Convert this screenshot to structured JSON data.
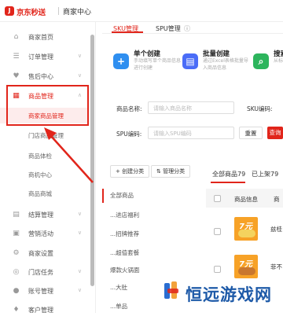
{
  "header": {
    "logo_glyph": "J",
    "brand": "京东秒送",
    "subtitle": "商家中心"
  },
  "sidebar": {
    "items": [
      {
        "label": "商家首页",
        "icon": "home-icon",
        "glyph": "⌂"
      },
      {
        "label": "订单管理",
        "icon": "order-icon",
        "glyph": "☰"
      },
      {
        "label": "售后中心",
        "icon": "aftersale-icon",
        "glyph": "♥"
      },
      {
        "label": "商品管理",
        "icon": "goods-icon",
        "glyph": "▦"
      },
      {
        "label": "结算管理",
        "icon": "settlement-icon",
        "glyph": "▤"
      },
      {
        "label": "营销活动",
        "icon": "marketing-icon",
        "glyph": "▣"
      },
      {
        "label": "商家设置",
        "icon": "settings-icon",
        "glyph": "⚙"
      },
      {
        "label": "门店任务",
        "icon": "task-icon",
        "glyph": "◎"
      },
      {
        "label": "账号管理",
        "icon": "account-icon",
        "glyph": "●"
      },
      {
        "label": "客户管理",
        "icon": "customer-icon",
        "glyph": "♦"
      }
    ],
    "sub_items": [
      "商家商品管理",
      "门店商品管理",
      "商品体检",
      "商机中心",
      "商品商城"
    ]
  },
  "tabs": [
    {
      "label": "SKU管理"
    },
    {
      "label": "SPU管理"
    },
    {
      "label": "ⓘ"
    }
  ],
  "create_cards": [
    {
      "title": "单个创建",
      "desc": "手动填写单个商品信息进行创建",
      "color": "#2f8ff0",
      "glyph": "+"
    },
    {
      "title": "批量创建",
      "desc": "通过Excel表格批量导入商品信息",
      "color": "#4a6cf7",
      "glyph": "▤"
    },
    {
      "title": "搜索",
      "desc": "从标库中搜索",
      "color": "#2db55d",
      "glyph": "⌕"
    }
  ],
  "filters": {
    "name_label": "商品名称:",
    "name_placeholder": "请输入商品名称",
    "sku_label": "SKU编码:",
    "spu_label": "SPU编码:",
    "spu_placeholder": "请输入SPU编码",
    "reset": "重置",
    "search": "查询"
  },
  "category_panel": {
    "create_btn": "+ 创建分类",
    "manage_btn": "管理分类",
    "items": [
      "全部商品",
      "...进店福利",
      "...招牌推荐",
      "...超值套餐",
      "爆款火锅面",
      "...大肚",
      "...单品"
    ]
  },
  "goods_list": {
    "stat_all": "全部商品79",
    "stat_onsale": "已上架79",
    "columns": [
      "商品信息",
      "商"
    ],
    "rows": [
      {
        "badge": "7元",
        "name": "兹桂"
      },
      {
        "badge": "7元",
        "name": "菲不"
      }
    ]
  },
  "watermark": {
    "text": "恒远游戏网"
  }
}
